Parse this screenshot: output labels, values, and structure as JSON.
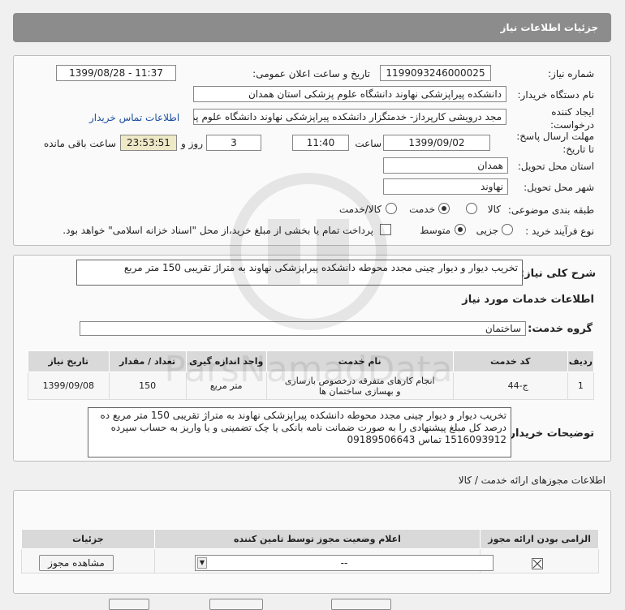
{
  "header": {
    "title": "جزئیات اطلاعات نیاز"
  },
  "form": {
    "need_number_label": "شماره نیاز:",
    "need_number": "1199093246000025",
    "announce_label": "تاریخ و ساعت اعلان عمومی:",
    "announce_value": "1399/08/28 - 11:37",
    "buyer_org_label": "نام دستگاه خریدار:",
    "buyer_org": "دانشکده پیراپزشکی نهاوند دانشگاه علوم پزشکی استان همدان",
    "creator_label": "ایجاد کننده درخواست:",
    "creator": "مجد درویشی کارپرداز- خدمتگزار دانشکده پیراپزشکی نهاوند دانشگاه علوم پزشکی",
    "contact_link": "اطلاعات تماس خریدار",
    "deadline_label": "مهلت ارسال پاسخ: تا تاریخ:",
    "deadline_date": "1399/09/02",
    "time_label": "ساعت",
    "deadline_time": "11:40",
    "days_label": "روز و",
    "days_value": "3",
    "remaining_time": "23:53:51",
    "remaining_label": "ساعت باقی مانده",
    "province_label": "استان محل تحویل:",
    "province": "همدان",
    "city_label": "شهر محل تحویل:",
    "city": "نهاوند",
    "category_label": "طبقه بندی موضوعی:",
    "category_options": [
      "کالا",
      "خدمت",
      "کالا/خدمت"
    ],
    "category_selected": "خدمت",
    "process_label": "نوع فرآیند خرید :",
    "process_options": [
      "جزیی",
      "متوسط"
    ],
    "process_selected": "متوسط",
    "payment_note": "پرداخت تمام یا بخشی از مبلغ خرید،از محل \"اسناد خزانه اسلامی\" خواهد بود."
  },
  "summary": {
    "label": "شرح کلی نیاز:",
    "text": "تخریب دیوار و دیوار چینی مجدد محوطه دانشکده پیراپزشکی نهاوند به متراژ تقریبی 150 متر مربع"
  },
  "services": {
    "section_title": "اطلاعات خدمات مورد نیاز",
    "group_label": "گروه خدمت:",
    "group_value": "ساختمان",
    "columns": [
      "ردیف",
      "کد خدمت",
      "نام خدمت",
      "واحد اندازه گیری",
      "تعداد / مقدار",
      "تاریخ نیاز"
    ],
    "rows": [
      {
        "row": "1",
        "code": "ج-44",
        "name": "انجام کارهای متفرقه درخصوص بازسازی و بهسازی ساختمان ها",
        "unit": "متر مربع",
        "qty": "150",
        "date": "1399/09/08"
      }
    ]
  },
  "buyer_notes": {
    "label": "توضیحات خریدار:",
    "text": "تخریب دیوار و دیوار چینی مجدد محوطه دانشکده پیراپزشکی نهاوند به متراژ تقریبی 150 متر مربع ده درصد کل مبلغ پیشنهادی را به صورت ضمانت نامه بانکی یا چک تضمینی و یا واریز به حساب سپرده 1516093912 تماس 09189506643"
  },
  "permits": {
    "section_title": "اطلاعات مجوزهای ارائه خدمت / کالا",
    "columns": [
      "الزامی بودن ارائه مجوز",
      "اعلام وضعیت مجوز توسط تامین کننده",
      "جزئیات"
    ],
    "select_value": "--",
    "view_button": "مشاهده مجوز"
  },
  "watermark": {
    "text": "ParsNamadData"
  }
}
